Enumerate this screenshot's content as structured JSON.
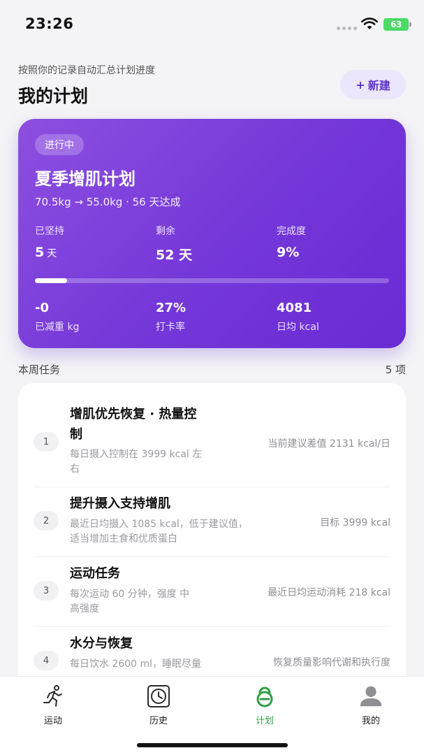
{
  "status_bar": {
    "time": "23:26",
    "battery": "63"
  },
  "header": {
    "subtitle": "按照你的记录自动汇总计划进度",
    "title": "我的计划",
    "new_button_icon": "+",
    "new_button_label": "新建"
  },
  "plan": {
    "status": "进行中",
    "title": "夏季增肌计划",
    "summary": "70.5kg → 55.0kg · 56 天达成",
    "stats": [
      {
        "label": "已坚持",
        "value": "5",
        "unit": "天"
      },
      {
        "label": "剩余",
        "value": "52 天",
        "unit": ""
      },
      {
        "label": "完成度",
        "value": "9%",
        "unit": ""
      }
    ],
    "progress_fraction": 0.09,
    "metrics": [
      {
        "value": "-0",
        "label": "已减重 kg"
      },
      {
        "value": "27%",
        "label": "打卡率"
      },
      {
        "value": "4081",
        "label": "日均 kcal"
      }
    ]
  },
  "tasks_section": {
    "title": "本周任务",
    "count": "5 项",
    "tasks": [
      {
        "num": "1",
        "title_lines": [
          "增肌优先恢复 · 热量控",
          "制"
        ],
        "desc_lines": [
          "每日摄入控制在 3999 kcal 左",
          "右"
        ],
        "meta": "当前建议差值 2131 kcal/日"
      },
      {
        "num": "2",
        "title_lines": [
          "提升摄入支持增肌"
        ],
        "desc_lines": [
          "最近日均摄入 1085 kcal，低于建议值，",
          "适当增加主食和优质蛋白"
        ],
        "meta": "目标 3999 kcal"
      },
      {
        "num": "3",
        "title_lines": [
          "运动任务"
        ],
        "desc_lines": [
          "每次运动 60 分钟，强度 中",
          "高强度"
        ],
        "meta": "最近日均运动消耗 218 kcal"
      },
      {
        "num": "4",
        "title_lines": [
          "水分与恢复"
        ],
        "desc_lines": [
          "每日饮水 2600 ml，睡眠尽量"
        ],
        "meta": "恢复质量影响代谢和执行度"
      }
    ]
  },
  "tab_bar": {
    "items": [
      {
        "label": "运动",
        "icon": "running-icon"
      },
      {
        "label": "历史",
        "icon": "clock-icon"
      },
      {
        "label": "计划",
        "icon": "kettlebell-icon"
      },
      {
        "label": "我的",
        "icon": "person-icon"
      }
    ],
    "active_color": "#2f9e44"
  },
  "colors": {
    "accent": "#7437d8",
    "accent_light": "#ebe6fb",
    "active_tab": "#2f9e44"
  }
}
